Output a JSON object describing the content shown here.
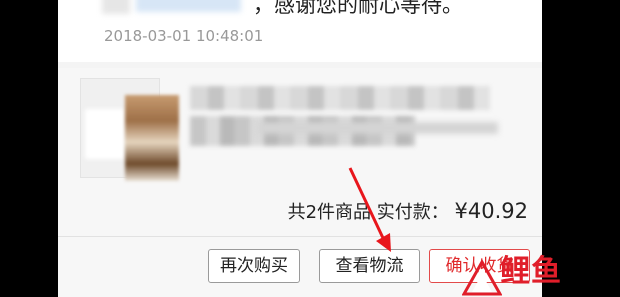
{
  "message": {
    "text": "，感谢您的耐心等待。",
    "timestamp": "2018-03-01 10:48:01"
  },
  "order": {
    "summary_count": "共2件商品",
    "summary_paid_label": "实付款：",
    "summary_total": "¥40.92",
    "buttons": {
      "rebuy": "再次购买",
      "logistics": "查看物流",
      "confirm": "确认收货"
    }
  },
  "watermark": {
    "text": "鲤鱼",
    "color": "#e01e2a"
  },
  "colors": {
    "accent": "#e0292b",
    "annotation_arrow": "#e8161c"
  }
}
